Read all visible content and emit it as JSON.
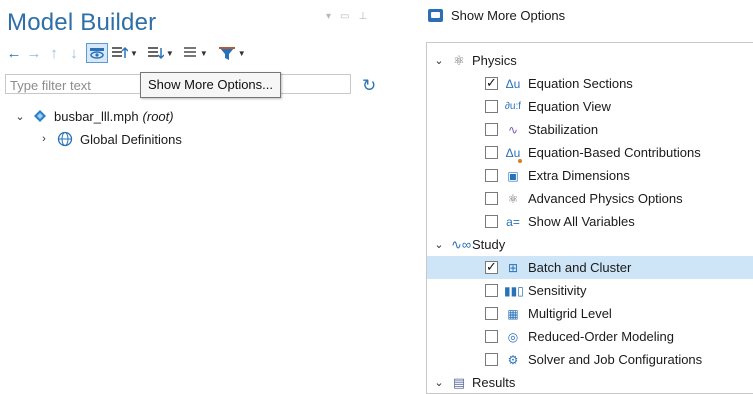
{
  "model_builder": {
    "title": "Model Builder",
    "filter_placeholder": "Type filter text",
    "tooltip": "Show More Options...",
    "tree": [
      {
        "label": "busbar_lll.mph",
        "suffix": "(root)",
        "expanded": true
      },
      {
        "label": "Global Definitions",
        "expanded": false
      }
    ],
    "toolbar_icons": [
      "back-arrow-icon",
      "forward-arrow-icon",
      "up-arrow-icon",
      "down-arrow-icon",
      "show-more-options-icon",
      "expand-icon",
      "collapse-icon",
      "list-view-icon",
      "filter-funnel-icon"
    ]
  },
  "show_more_options": {
    "title": "Show More Options",
    "groups": [
      {
        "label": "Physics",
        "icon": "physics-icon",
        "items": [
          {
            "label": "Equation Sections",
            "checked": true,
            "icon": "delta-u-icon"
          },
          {
            "label": "Equation View",
            "checked": false,
            "icon": "equation-view-icon"
          },
          {
            "label": "Stabilization",
            "checked": false,
            "icon": "stabilization-icon"
          },
          {
            "label": "Equation-Based Contributions",
            "checked": false,
            "icon": "delta-u-orange-icon"
          },
          {
            "label": "Extra Dimensions",
            "checked": false,
            "icon": "extra-dimensions-icon"
          },
          {
            "label": "Advanced Physics Options",
            "checked": false,
            "icon": "physics-icon"
          },
          {
            "label": "Show All Variables",
            "checked": false,
            "icon": "variables-icon"
          }
        ]
      },
      {
        "label": "Study",
        "icon": "study-icon",
        "items": [
          {
            "label": "Batch and Cluster",
            "checked": true,
            "icon": "batch-cluster-icon",
            "selected": true
          },
          {
            "label": "Sensitivity",
            "checked": false,
            "icon": "sensitivity-icon"
          },
          {
            "label": "Multigrid Level",
            "checked": false,
            "icon": "multigrid-icon"
          },
          {
            "label": "Reduced-Order Modeling",
            "checked": false,
            "icon": "reduced-order-icon"
          },
          {
            "label": "Solver and Job Configurations",
            "checked": false,
            "icon": "solver-config-icon"
          }
        ]
      },
      {
        "label": "Results",
        "icon": "results-icon",
        "items": []
      }
    ]
  },
  "colors": {
    "accent": "#2e6fa8",
    "selection": "#cde5f7",
    "border": "#c8c8c8"
  }
}
